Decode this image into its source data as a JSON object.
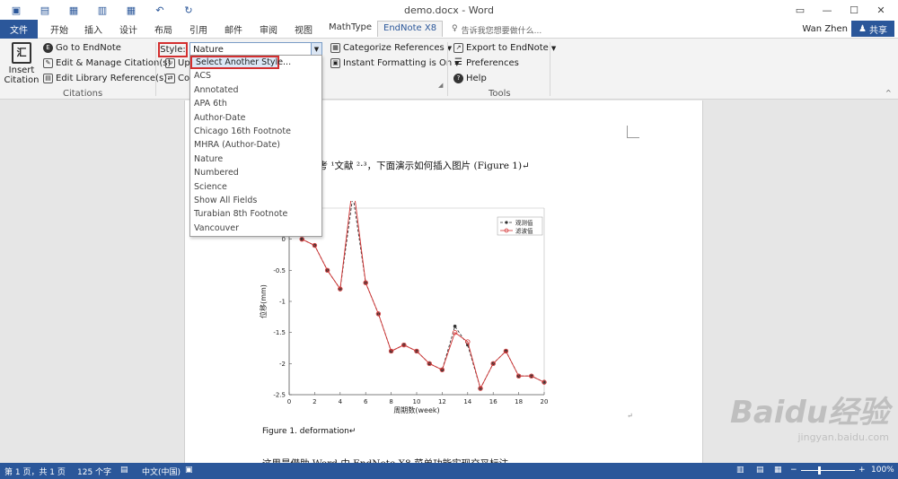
{
  "titlebar": {
    "doc_title": "demo.docx - Word",
    "qat_undo": "↶",
    "qat_redo": "↻"
  },
  "tabs": {
    "file": "文件",
    "home": "开始",
    "insert": "插入",
    "design": "设计",
    "layout": "布局",
    "references": "引用",
    "mailings": "邮件",
    "review": "审阅",
    "view": "视图",
    "mathtype": "MathType",
    "endnote": "EndNote X8"
  },
  "tellme": "告诉我您想要做什么...",
  "user": "Wan Zhen",
  "share": "共享",
  "ribbon": {
    "insert_citation": "Insert Citation",
    "go_to_endnote": "Go to EndNote",
    "edit_manage": "Edit & Manage Citation(s)",
    "edit_library": "Edit Library Reference(s)",
    "citations_group": "Citations",
    "style_label": "Style:",
    "style_value": "Nature",
    "update_partial": "Up",
    "convert_partial": "Co",
    "categorize": "Categorize References",
    "instant_formatting": "Instant Formatting is On",
    "export": "Export to EndNote",
    "preferences": "Preferences",
    "help": "Help",
    "tools_group": "Tools"
  },
  "style_dropdown": [
    "Select Another Style...",
    "ACS",
    "Annotated",
    "APA 6th",
    "Author-Date",
    "Chicago 16th Footnote",
    "MHRA (Author-Date)",
    "Nature",
    "Numbered",
    "Science",
    "Show All Fields",
    "Turabian 8th Footnote",
    "Vancouver"
  ],
  "document": {
    "line1": "参考 ¹文献 ²·³，下面演示如何插入图片 (Figure 1)↵",
    "caption": "Figure 1. deformation↵",
    "line2": "这里是借助 Word 中 EndNote X8 菜单功能实现交叉标注。",
    "para_mark": "↵"
  },
  "chart_data": {
    "type": "line",
    "xlabel": "周期数(week)",
    "ylabel": "位移(mm)",
    "xlim": [
      0,
      20
    ],
    "ylim": [
      -2.5,
      0.5
    ],
    "x_ticks": [
      "0",
      "2",
      "4",
      "6",
      "8",
      "10",
      "12",
      "14",
      "16",
      "18",
      "20"
    ],
    "y_ticks": [
      "-2.5",
      "-2",
      "-1.5",
      "-1",
      "-0.5",
      "0"
    ],
    "x": [
      1,
      2,
      3,
      4,
      5,
      6,
      7,
      8,
      9,
      10,
      11,
      12,
      13,
      14,
      15,
      16,
      17,
      18,
      19,
      20
    ],
    "series": [
      {
        "name": "观测值",
        "color": "#333333",
        "values": [
          0,
          -0.1,
          -0.5,
          -0.8,
          0.7,
          -0.7,
          -1.2,
          -1.8,
          -1.7,
          -1.8,
          -2.0,
          -2.1,
          -1.4,
          -1.7,
          -2.4,
          -2.0,
          -1.8,
          -2.2,
          -2.2,
          -2.3
        ]
      },
      {
        "name": "滤波值",
        "color": "#d32f2f",
        "values": [
          0,
          -0.1,
          -0.5,
          -0.8,
          0.9,
          -0.7,
          -1.2,
          -1.8,
          -1.7,
          -1.8,
          -2.0,
          -2.1,
          -1.5,
          -1.65,
          -2.4,
          -2.0,
          -1.8,
          -2.2,
          -2.2,
          -2.3
        ]
      }
    ],
    "legend": "top-right"
  },
  "status": {
    "page": "第 1 页，共 1 页",
    "words": "125 个字",
    "lang": "中文(中国)",
    "zoom": "100%"
  },
  "watermark": {
    "main": "Baidu经验",
    "sub": "jingyan.baidu.com"
  },
  "colors": {
    "accent": "#2b579a",
    "highlight": "#d32f2f"
  }
}
